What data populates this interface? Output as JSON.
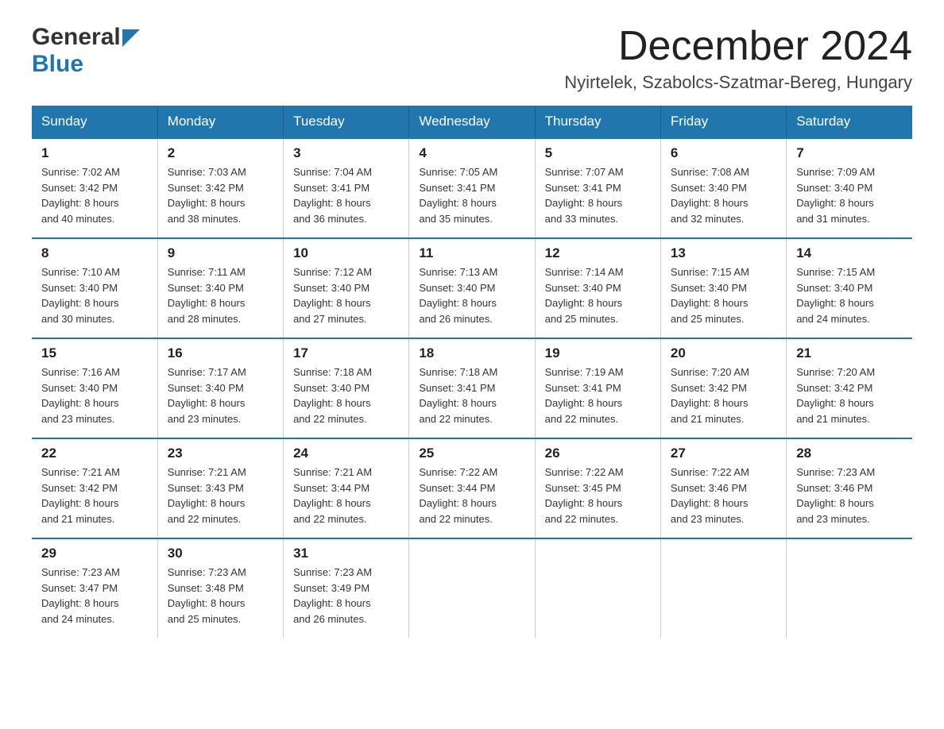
{
  "logo": {
    "part1": "General",
    "part2": "Blue"
  },
  "header": {
    "month": "December 2024",
    "location": "Nyirtelek, Szabolcs-Szatmar-Bereg, Hungary"
  },
  "weekdays": [
    "Sunday",
    "Monday",
    "Tuesday",
    "Wednesday",
    "Thursday",
    "Friday",
    "Saturday"
  ],
  "weeks": [
    [
      {
        "day": "1",
        "sunrise": "7:02 AM",
        "sunset": "3:42 PM",
        "daylight": "8 hours and 40 minutes."
      },
      {
        "day": "2",
        "sunrise": "7:03 AM",
        "sunset": "3:42 PM",
        "daylight": "8 hours and 38 minutes."
      },
      {
        "day": "3",
        "sunrise": "7:04 AM",
        "sunset": "3:41 PM",
        "daylight": "8 hours and 36 minutes."
      },
      {
        "day": "4",
        "sunrise": "7:05 AM",
        "sunset": "3:41 PM",
        "daylight": "8 hours and 35 minutes."
      },
      {
        "day": "5",
        "sunrise": "7:07 AM",
        "sunset": "3:41 PM",
        "daylight": "8 hours and 33 minutes."
      },
      {
        "day": "6",
        "sunrise": "7:08 AM",
        "sunset": "3:40 PM",
        "daylight": "8 hours and 32 minutes."
      },
      {
        "day": "7",
        "sunrise": "7:09 AM",
        "sunset": "3:40 PM",
        "daylight": "8 hours and 31 minutes."
      }
    ],
    [
      {
        "day": "8",
        "sunrise": "7:10 AM",
        "sunset": "3:40 PM",
        "daylight": "8 hours and 30 minutes."
      },
      {
        "day": "9",
        "sunrise": "7:11 AM",
        "sunset": "3:40 PM",
        "daylight": "8 hours and 28 minutes."
      },
      {
        "day": "10",
        "sunrise": "7:12 AM",
        "sunset": "3:40 PM",
        "daylight": "8 hours and 27 minutes."
      },
      {
        "day": "11",
        "sunrise": "7:13 AM",
        "sunset": "3:40 PM",
        "daylight": "8 hours and 26 minutes."
      },
      {
        "day": "12",
        "sunrise": "7:14 AM",
        "sunset": "3:40 PM",
        "daylight": "8 hours and 25 minutes."
      },
      {
        "day": "13",
        "sunrise": "7:15 AM",
        "sunset": "3:40 PM",
        "daylight": "8 hours and 25 minutes."
      },
      {
        "day": "14",
        "sunrise": "7:15 AM",
        "sunset": "3:40 PM",
        "daylight": "8 hours and 24 minutes."
      }
    ],
    [
      {
        "day": "15",
        "sunrise": "7:16 AM",
        "sunset": "3:40 PM",
        "daylight": "8 hours and 23 minutes."
      },
      {
        "day": "16",
        "sunrise": "7:17 AM",
        "sunset": "3:40 PM",
        "daylight": "8 hours and 23 minutes."
      },
      {
        "day": "17",
        "sunrise": "7:18 AM",
        "sunset": "3:40 PM",
        "daylight": "8 hours and 22 minutes."
      },
      {
        "day": "18",
        "sunrise": "7:18 AM",
        "sunset": "3:41 PM",
        "daylight": "8 hours and 22 minutes."
      },
      {
        "day": "19",
        "sunrise": "7:19 AM",
        "sunset": "3:41 PM",
        "daylight": "8 hours and 22 minutes."
      },
      {
        "day": "20",
        "sunrise": "7:20 AM",
        "sunset": "3:42 PM",
        "daylight": "8 hours and 21 minutes."
      },
      {
        "day": "21",
        "sunrise": "7:20 AM",
        "sunset": "3:42 PM",
        "daylight": "8 hours and 21 minutes."
      }
    ],
    [
      {
        "day": "22",
        "sunrise": "7:21 AM",
        "sunset": "3:42 PM",
        "daylight": "8 hours and 21 minutes."
      },
      {
        "day": "23",
        "sunrise": "7:21 AM",
        "sunset": "3:43 PM",
        "daylight": "8 hours and 22 minutes."
      },
      {
        "day": "24",
        "sunrise": "7:21 AM",
        "sunset": "3:44 PM",
        "daylight": "8 hours and 22 minutes."
      },
      {
        "day": "25",
        "sunrise": "7:22 AM",
        "sunset": "3:44 PM",
        "daylight": "8 hours and 22 minutes."
      },
      {
        "day": "26",
        "sunrise": "7:22 AM",
        "sunset": "3:45 PM",
        "daylight": "8 hours and 22 minutes."
      },
      {
        "day": "27",
        "sunrise": "7:22 AM",
        "sunset": "3:46 PM",
        "daylight": "8 hours and 23 minutes."
      },
      {
        "day": "28",
        "sunrise": "7:23 AM",
        "sunset": "3:46 PM",
        "daylight": "8 hours and 23 minutes."
      }
    ],
    [
      {
        "day": "29",
        "sunrise": "7:23 AM",
        "sunset": "3:47 PM",
        "daylight": "8 hours and 24 minutes."
      },
      {
        "day": "30",
        "sunrise": "7:23 AM",
        "sunset": "3:48 PM",
        "daylight": "8 hours and 25 minutes."
      },
      {
        "day": "31",
        "sunrise": "7:23 AM",
        "sunset": "3:49 PM",
        "daylight": "8 hours and 26 minutes."
      },
      null,
      null,
      null,
      null
    ]
  ],
  "labels": {
    "sunrise": "Sunrise: ",
    "sunset": "Sunset: ",
    "daylight": "Daylight: "
  }
}
